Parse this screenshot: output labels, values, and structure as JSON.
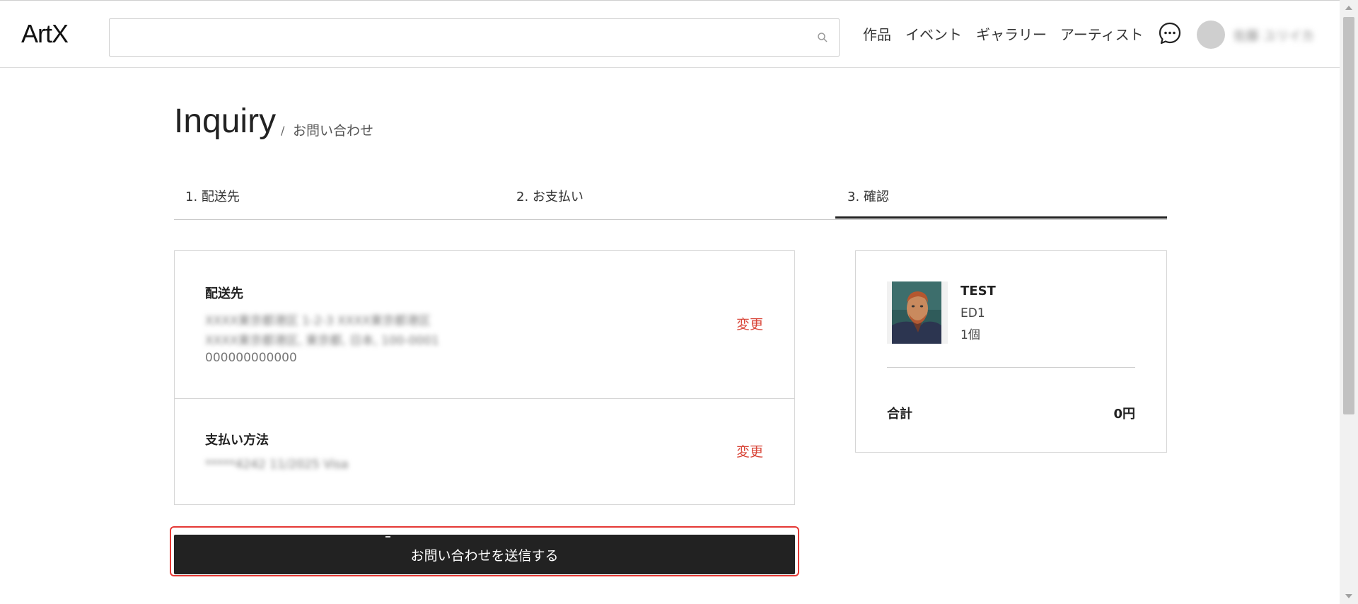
{
  "header": {
    "logo": "ArtX",
    "search": {
      "value": "",
      "placeholder": ""
    },
    "nav": [
      "作品",
      "イベント",
      "ギャラリー",
      "アーティスト"
    ],
    "username": "佐藤 ユリイカ"
  },
  "page": {
    "title": "Inquiry",
    "separator": "/",
    "subtitle": "お問い合わせ"
  },
  "steps": [
    {
      "label": "1. 配送先"
    },
    {
      "label": "2. お支払い"
    },
    {
      "label": "3. 確認"
    }
  ],
  "shipping": {
    "title": "配送先",
    "address_line1": "XXXX東京都港区 1-2-3 XXXX東京都港区",
    "address_line2": "XXXX東京都港区, 東京都, 日本, 100-0001",
    "phone": "000000000000",
    "change_label": "変更"
  },
  "payment": {
    "title": "支払い方法",
    "card": "*****4242 11/2025 Visa",
    "change_label": "変更"
  },
  "order": {
    "product_name": "TEST",
    "edition": "ED1",
    "quantity": "1個",
    "total_label": "合計",
    "total_value": "0円"
  },
  "submit": {
    "label": "お問い合わせを送信する"
  },
  "colors": {
    "accent": "#d9473a",
    "button": "#222222",
    "highlight": "#e53935"
  }
}
